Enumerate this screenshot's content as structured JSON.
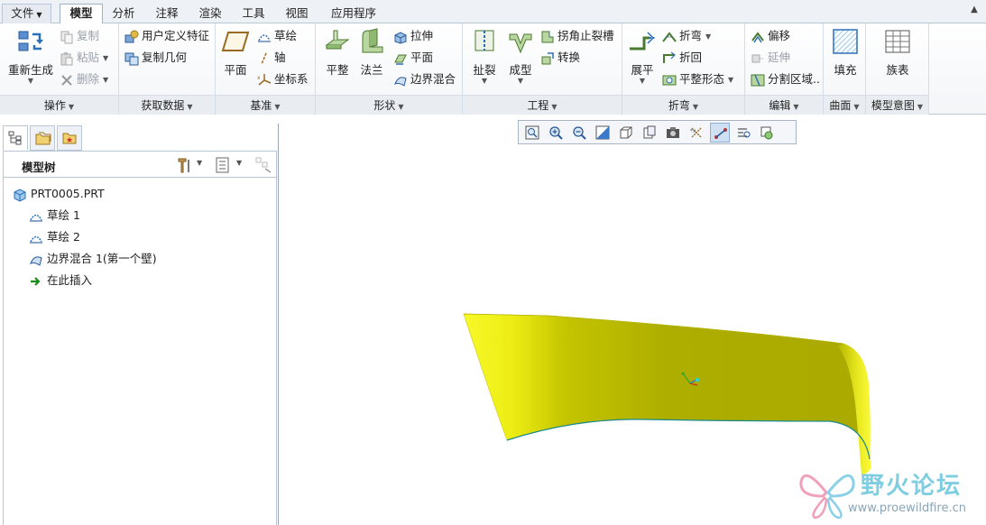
{
  "tabs": {
    "file": "文件",
    "model": "模型",
    "analysis": "分析",
    "annotate": "注释",
    "render": "渲染",
    "tools": "工具",
    "view": "视图",
    "apps": "应用程序"
  },
  "ribbon": {
    "operations": {
      "label": "操作",
      "regenerate": "重新生成",
      "copy": "复制",
      "paste": "粘贴",
      "delete": "删除"
    },
    "get_data": {
      "label": "获取数据",
      "udf": "用户定义特征",
      "copy_geom": "复制几何"
    },
    "datum": {
      "label": "基准",
      "plane": "平面",
      "sketch": "草绘",
      "axis": "轴",
      "csys": "坐标系"
    },
    "shapes": {
      "label": "形状",
      "flat": "平整",
      "flange": "法兰",
      "extrude": "拉伸",
      "planar": "平面",
      "boundary_blend": "边界混合"
    },
    "engineering": {
      "label": "工程",
      "rip": "扯裂",
      "form": "成型",
      "corner_relief": "拐角止裂槽",
      "convert": "转换"
    },
    "bends": {
      "label": "折弯",
      "unbend": "展平",
      "bend": "折弯",
      "bend_back": "折回",
      "flatten_form": "平整形态"
    },
    "editing": {
      "label": "编辑",
      "offset": "偏移",
      "extend": "延伸",
      "split_area": "分割区域.."
    },
    "surfaces": {
      "label": "曲面",
      "fill": "填充"
    },
    "model_intent": {
      "label": "模型意图",
      "family_table": "族表"
    }
  },
  "model_tree": {
    "title": "模型树",
    "nodes": [
      {
        "label": "PRT0005.PRT",
        "icon": "part-icon"
      },
      {
        "label": "草绘 1",
        "icon": "sketch-icon"
      },
      {
        "label": "草绘 2",
        "icon": "sketch-icon"
      },
      {
        "label": "边界混合 1(第一个壁)",
        "icon": "boundary-blend-icon"
      },
      {
        "label": "在此插入",
        "icon": "insert-arrow-icon"
      }
    ]
  },
  "watermark": {
    "title": "野火论坛",
    "url": "www.proewildfire.cn"
  },
  "colors": {
    "surface_light": "#f5f520",
    "surface_dark": "#a8a800",
    "accent": "#2a6fb8"
  }
}
